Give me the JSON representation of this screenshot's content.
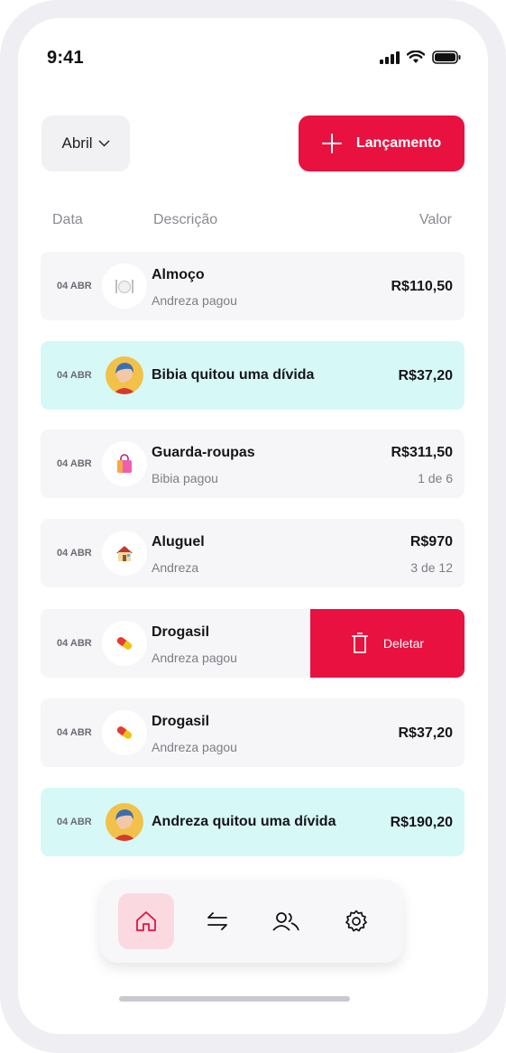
{
  "status_bar": {
    "time": "9:41"
  },
  "header": {
    "month_label": "Abril",
    "add_button_label": "Lançamento"
  },
  "columns": {
    "date": "Data",
    "description": "Descrição",
    "value": "Valor"
  },
  "rows": [
    {
      "date": "04 ABR",
      "icon": "plate-icon",
      "title": "Almoço",
      "subtitle": "Andreza pagou",
      "amount": "R$110,50"
    },
    {
      "date": "04 ABR",
      "icon": "avatar",
      "title": "Bibia quitou uma dívida",
      "amount": "R$37,20"
    },
    {
      "date": "04 ABR",
      "icon": "shopping-bag-icon",
      "title": "Guarda-roupas",
      "subtitle": "Bibia pagou",
      "amount": "R$311,50",
      "installment": "1 de 6"
    },
    {
      "date": "04 ABR",
      "icon": "house-icon",
      "title": "Aluguel",
      "subtitle": "Andreza",
      "amount": "R$970",
      "installment": "3 de 12"
    },
    {
      "date": "04 ABR",
      "icon": "pill-icon",
      "title": "Drogasil",
      "subtitle": "Andreza pagou"
    },
    {
      "date": "04 ABR",
      "icon": "pill-icon",
      "title": "Drogasil",
      "subtitle": "Andreza pagou",
      "amount": "R$37,20"
    },
    {
      "date": "04 ABR",
      "icon": "avatar",
      "title": "Andreza quitou uma dívida",
      "amount": "R$190,20"
    }
  ],
  "swipe_action": {
    "label": "Deletar"
  },
  "nav": {
    "items": [
      "home-icon",
      "transfer-icon",
      "users-icon",
      "settings-icon"
    ],
    "active": "home-icon"
  },
  "colors": {
    "accent": "#e8113f",
    "settle_bg": "#d6f9f7",
    "row_bg": "#f6f6f8"
  }
}
